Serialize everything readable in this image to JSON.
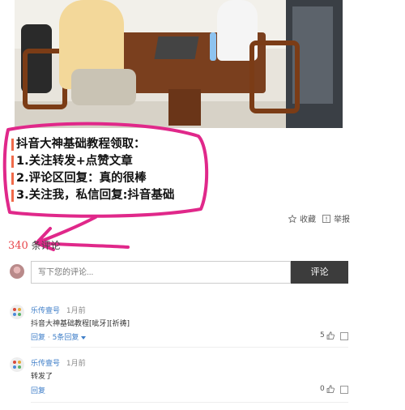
{
  "caption": {
    "lines": [
      "抖音大神基础教程领取：",
      "1.关注转发+点赞文章",
      "2.评论区回复：真的很棒",
      "3.关注我，私信回复:抖音基础"
    ]
  },
  "actions": {
    "collect_label": "收藏",
    "report_label": "举报"
  },
  "comments_header": {
    "count": "340",
    "label": "条评论"
  },
  "comment_input": {
    "placeholder": "写下您的评论...",
    "submit_label": "评论"
  },
  "comments": [
    {
      "user": "乐传壹号",
      "time": "1月前",
      "text": "抖音大神基础教程[呲牙][祈祷]",
      "reply_label": "回复",
      "replies_label": "5条回复",
      "likes": "5"
    },
    {
      "user": "乐传壹号",
      "time": "1月前",
      "text": "转发了",
      "reply_label": "回复",
      "likes": "0"
    }
  ],
  "colors": {
    "annotation_magenta": "#e0288a",
    "count_red": "#e8454a",
    "link_blue": "#3e7ec8",
    "submit_bg": "#3c3c3c"
  }
}
